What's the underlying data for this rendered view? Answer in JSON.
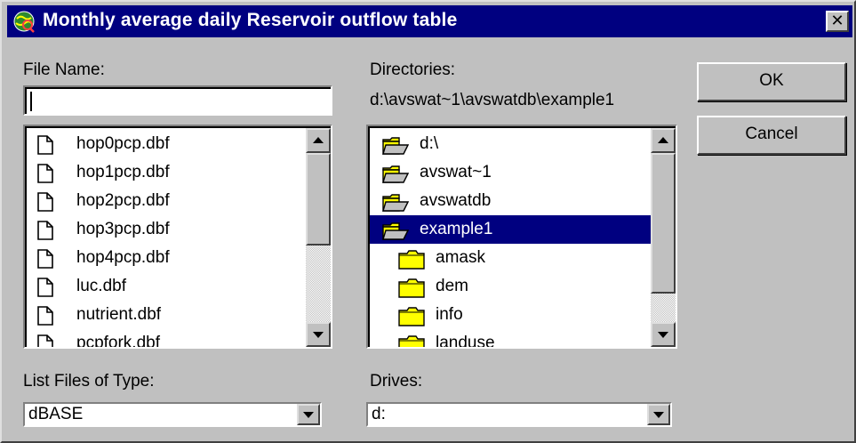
{
  "window": {
    "title": "Monthly average daily Reservoir outflow table",
    "close_label": "✕"
  },
  "file_name": {
    "label": "File Name:",
    "value": ""
  },
  "files": [
    "hop0pcp.dbf",
    "hop1pcp.dbf",
    "hop2pcp.dbf",
    "hop3pcp.dbf",
    "hop4pcp.dbf",
    "luc.dbf",
    "nutrient.dbf",
    "pcpfork.dbf"
  ],
  "directories": {
    "label": "Directories:",
    "path": "d:\\avswat~1\\avswatdb\\example1",
    "items": [
      {
        "name": "d:\\",
        "icon": "open-folder-icon"
      },
      {
        "name": "avswat~1",
        "icon": "open-folder-icon"
      },
      {
        "name": "avswatdb",
        "icon": "open-folder-icon"
      },
      {
        "name": "example1",
        "icon": "open-folder-icon",
        "selected": true
      },
      {
        "name": "amask",
        "icon": "folder-icon"
      },
      {
        "name": "dem",
        "icon": "folder-icon"
      },
      {
        "name": "info",
        "icon": "folder-icon"
      },
      {
        "name": "landuse",
        "icon": "folder-icon"
      }
    ]
  },
  "buttons": {
    "ok": "OK",
    "cancel": "Cancel"
  },
  "file_type": {
    "label": "List Files of Type:",
    "value": "dBASE"
  },
  "drives": {
    "label": "Drives:",
    "value": "d:"
  },
  "colors": {
    "titlebar": "#000080",
    "selection": "#000080",
    "face": "#c0c0c0",
    "folder": "#ffff00"
  }
}
